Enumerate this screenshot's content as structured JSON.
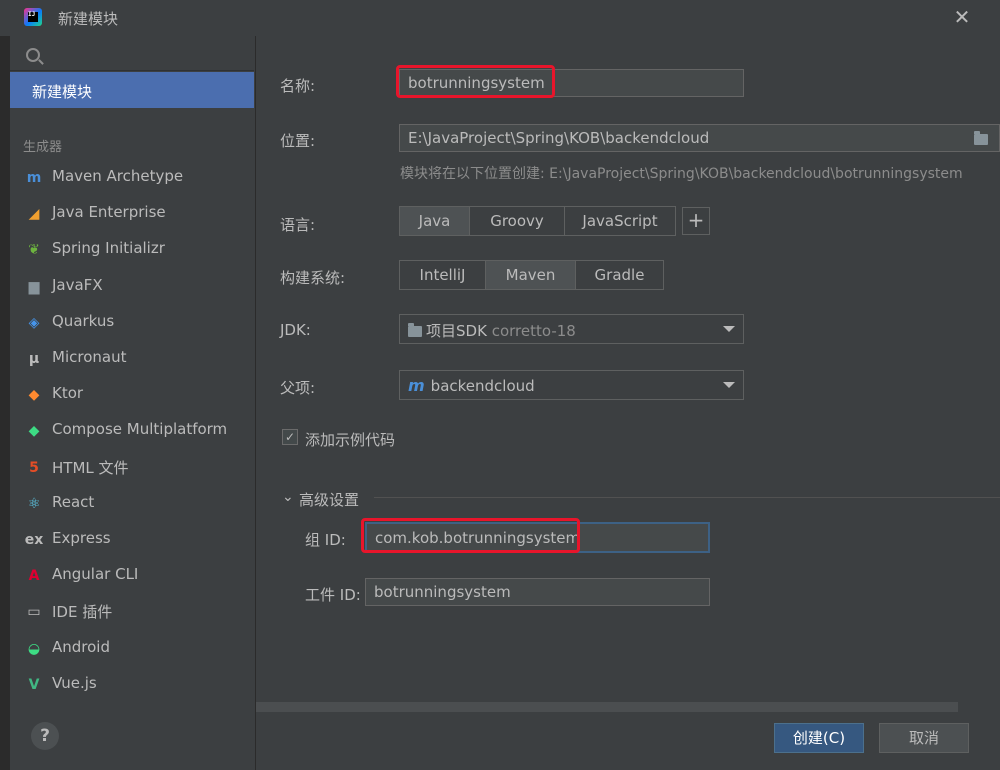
{
  "window": {
    "title": "新建模块",
    "close_glyph": "✕"
  },
  "sidebar": {
    "search_placeholder": "",
    "selected_label": "新建模块",
    "section_label": "生成器",
    "generators": [
      {
        "label": "Maven Archetype",
        "icon": "maven-icon",
        "glyph": "m",
        "color": "#4a8fd8"
      },
      {
        "label": "Java Enterprise",
        "icon": "java-enterprise-icon",
        "glyph": "◢",
        "color": "#f0a030"
      },
      {
        "label": "Spring Initializr",
        "icon": "spring-icon",
        "glyph": "❦",
        "color": "#6db33f"
      },
      {
        "label": "JavaFX",
        "icon": "javafx-folder-icon",
        "glyph": "▆",
        "color": "#87939a"
      },
      {
        "label": "Quarkus",
        "icon": "quarkus-icon",
        "glyph": "◈",
        "color": "#4695eb"
      },
      {
        "label": "Micronaut",
        "icon": "micronaut-icon",
        "glyph": "μ",
        "color": "#bbbbbb"
      },
      {
        "label": "Ktor",
        "icon": "ktor-icon",
        "glyph": "◆",
        "color": "#ff8a30"
      },
      {
        "label": "Compose Multiplatform",
        "icon": "compose-icon",
        "glyph": "◆",
        "color": "#3ddc84"
      },
      {
        "label": "HTML 文件",
        "icon": "html5-icon",
        "glyph": "5",
        "color": "#e44d26"
      },
      {
        "label": "React",
        "icon": "react-icon",
        "glyph": "⚛",
        "color": "#61dafb"
      },
      {
        "label": "Express",
        "icon": "express-icon",
        "glyph": "ex",
        "color": "#bbbbbb"
      },
      {
        "label": "Angular CLI",
        "icon": "angular-icon",
        "glyph": "A",
        "color": "#dd0031"
      },
      {
        "label": "IDE 插件",
        "icon": "plugin-icon",
        "glyph": "▭",
        "color": "#bbbbbb"
      },
      {
        "label": "Android",
        "icon": "android-icon",
        "glyph": "◒",
        "color": "#3ddc84"
      },
      {
        "label": "Vue.js",
        "icon": "vue-icon",
        "glyph": "V",
        "color": "#41b883"
      }
    ],
    "help_glyph": "?"
  },
  "form": {
    "name_label": "名称:",
    "name_value": "botrunningsystem",
    "location_label": "位置:",
    "location_value": "E:\\JavaProject\\Spring\\KOB\\backendcloud",
    "location_hint": "模块将在以下位置创建: E:\\JavaProject\\Spring\\KOB\\backendcloud\\botrunningsystem",
    "language_label": "语言:",
    "languages": [
      "Java",
      "Groovy",
      "JavaScript"
    ],
    "language_selected": "Java",
    "add_glyph": "+",
    "build_label": "构建系统:",
    "build_systems": [
      "IntelliJ",
      "Maven",
      "Gradle"
    ],
    "build_selected": "Maven",
    "jdk_label": "JDK:",
    "jdk_prefix": "项目SDK",
    "jdk_value": "corretto-18",
    "parent_label": "父项:",
    "parent_value": "backendcloud",
    "sample_code_label": "添加示例代码",
    "sample_code_checked": true,
    "advanced_label": "高级设置",
    "group_id_label": "组 ID:",
    "group_id_value": "com.kob.botrunningsystem",
    "artifact_id_label": "工件 ID:",
    "artifact_id_value": "botrunningsystem"
  },
  "footer": {
    "create_label": "创建(C)",
    "cancel_label": "取消"
  },
  "colors": {
    "highlight": "#e8152b",
    "accent": "#4b6eaf",
    "primary_button": "#365880"
  }
}
